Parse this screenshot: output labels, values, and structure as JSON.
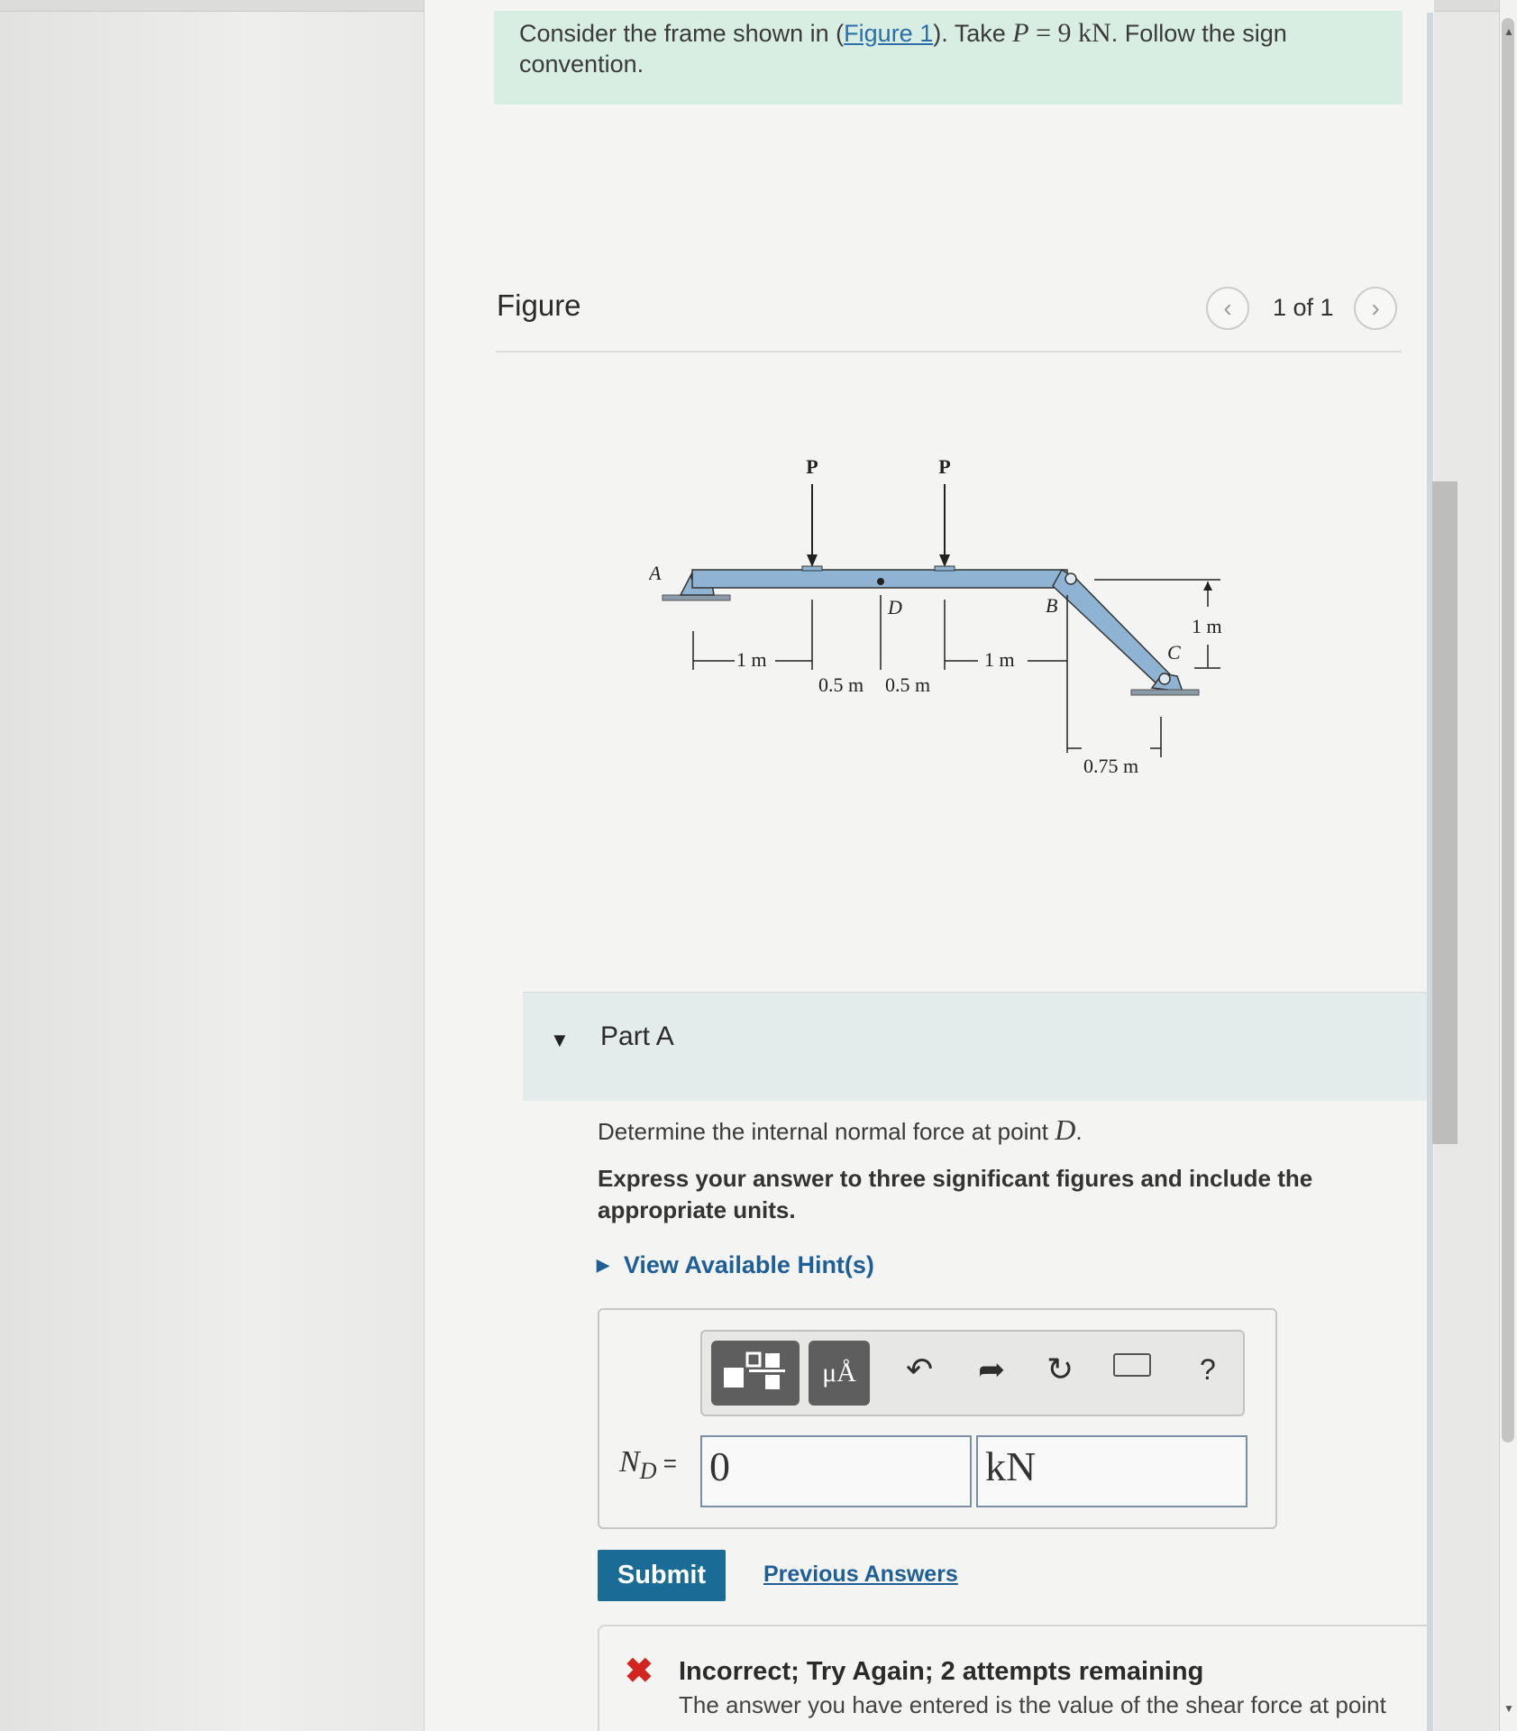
{
  "prompt": {
    "text_before": "Consider the frame shown in (",
    "figure_link": "Figure 1",
    "text_mid": "). Take ",
    "var": "P",
    "eq": " = 9 ",
    "unit": "kN",
    "text_after": ". Follow the sign convention."
  },
  "figure": {
    "title": "Figure",
    "pager_text": "1 of 1",
    "prev_icon": "chevron-left-icon",
    "next_icon": "chevron-right-icon",
    "labels": {
      "P1": "P",
      "P2": "P",
      "A": "A",
      "D": "D",
      "B": "B",
      "C": "C",
      "dim_1m_left": "1 m",
      "dim_05_left": "0.5 m",
      "dim_05_right": "0.5 m",
      "dim_1m_right": "1 m",
      "dim_1m_vertical": "1 m",
      "dim_075": "0.75 m"
    }
  },
  "part": {
    "title": "Part A",
    "question_text": "Determine the internal normal force at point ",
    "question_var": "D",
    "question_end": ".",
    "instructions": "Express your answer to three significant figures and include the appropriate units.",
    "hints_label": "View Available Hint(s)"
  },
  "toolbar": {
    "templates_icon": "templates-icon",
    "symbols_label": "μÅ",
    "undo_icon": "undo-icon",
    "redo_icon": "redo-icon",
    "reset_icon": "reset-icon",
    "keyboard_icon": "keyboard-icon",
    "help_label": "?"
  },
  "answer": {
    "label_var": "N",
    "label_sub": "D",
    "label_eq": " =",
    "value": "0",
    "unit": "kN"
  },
  "actions": {
    "submit_label": "Submit",
    "previous_answers_label": "Previous Answers"
  },
  "feedback": {
    "icon": "x-icon",
    "title": "Incorrect; Try Again; 2 attempts remaining",
    "detail": "The answer you have entered is the value of the shear force at point"
  },
  "colors": {
    "prompt_bg": "#d9eee3",
    "link": "#1f5f97",
    "submit_bg": "#1b6b97",
    "error": "#d4241f",
    "beam": "#8fb4d3"
  }
}
